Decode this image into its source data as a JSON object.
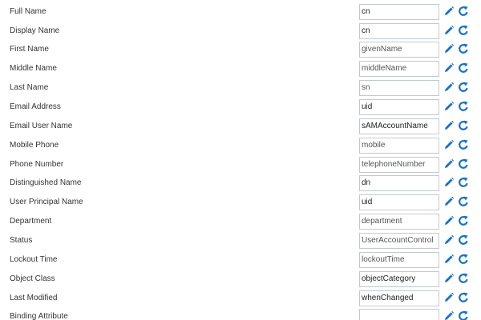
{
  "colors": {
    "icon_blue": "#1a72c0",
    "label_text": "#333333",
    "input_border": "#c3c9cf"
  },
  "icons": {
    "edit": "pencil-icon",
    "reset": "refresh-icon"
  },
  "fields": [
    {
      "label": "Full Name",
      "value": "cn"
    },
    {
      "label": "Display Name",
      "value": "cn"
    },
    {
      "label": "First Name",
      "value": "givenName"
    },
    {
      "label": "Middle Name",
      "value": "middleName"
    },
    {
      "label": "Last Name",
      "value": "sn"
    },
    {
      "label": "Email Address",
      "value": "uid"
    },
    {
      "label": "Email User Name",
      "value": "sAMAccountName"
    },
    {
      "label": "Mobile Phone",
      "value": "mobile"
    },
    {
      "label": "Phone Number",
      "value": "telephoneNumber"
    },
    {
      "label": "Distinguished Name",
      "value": "dn"
    },
    {
      "label": "User Principal Name",
      "value": "uid"
    },
    {
      "label": "Department",
      "value": "department"
    },
    {
      "label": "Status",
      "value": "UserAccountControl"
    },
    {
      "label": "Lockout Time",
      "value": "lockoutTime"
    },
    {
      "label": "Object Class",
      "value": "objectCategory"
    },
    {
      "label": "Last Modified",
      "value": "whenChanged"
    },
    {
      "label": "Binding Attribute",
      "value": ""
    }
  ]
}
